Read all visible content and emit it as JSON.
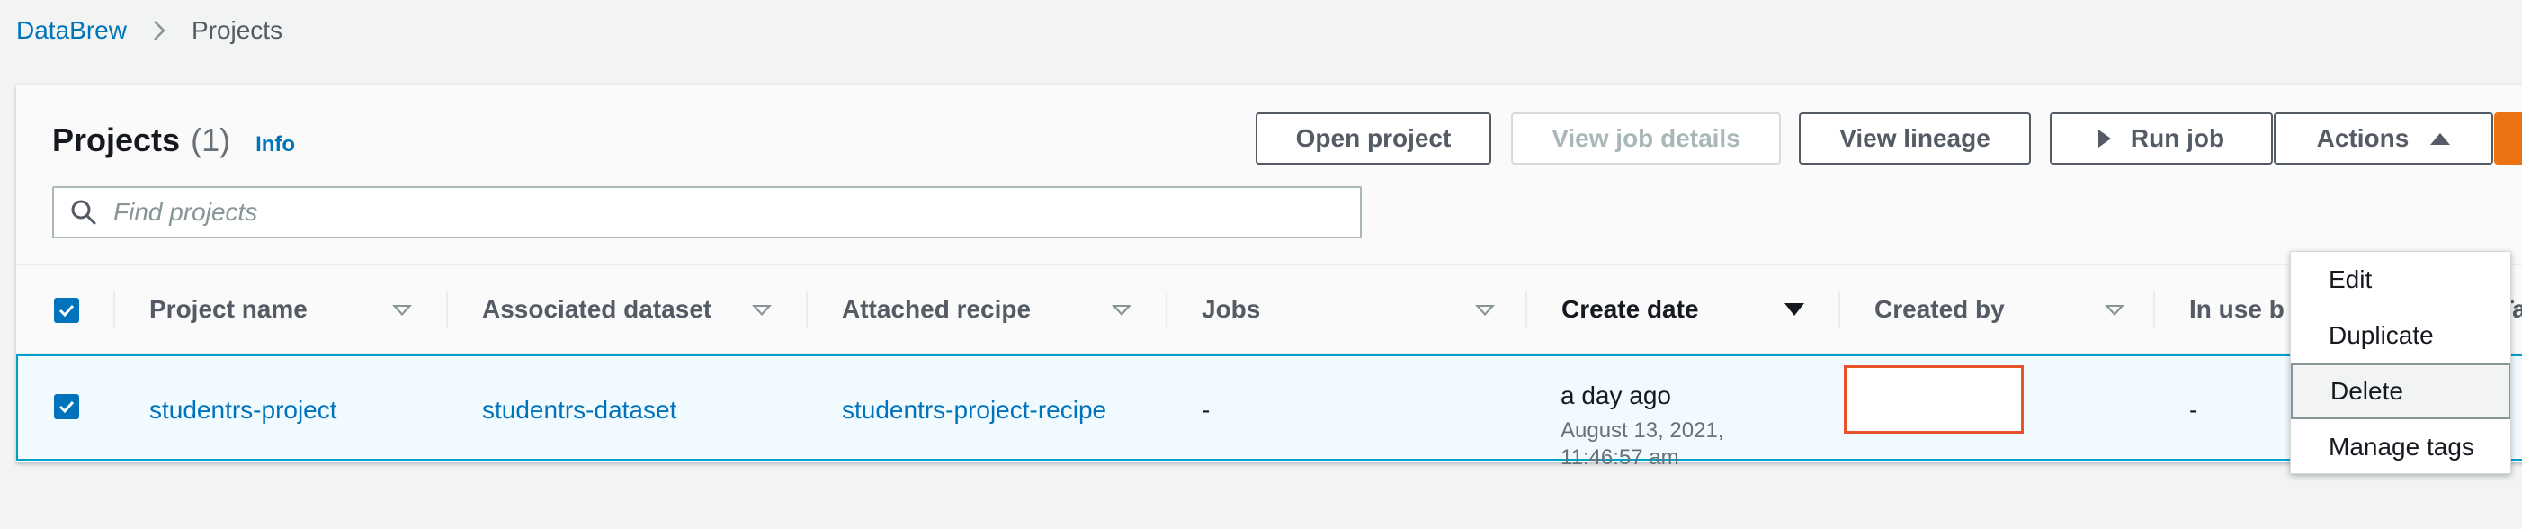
{
  "breadcrumb": {
    "root": "DataBrew",
    "current": "Projects"
  },
  "header": {
    "title": "Projects",
    "count": "(1)",
    "info": "Info"
  },
  "toolbar": {
    "open_project": "Open project",
    "view_job_details": "View job details",
    "view_lineage": "View lineage",
    "run_job": "Run job",
    "actions": "Actions"
  },
  "search": {
    "placeholder": "Find projects"
  },
  "table": {
    "columns": [
      "Project name",
      "Associated dataset",
      "Attached recipe",
      "Jobs",
      "Create date",
      "Created by",
      "In use b",
      "Ta"
    ],
    "sorted_column": "Create date",
    "rows": [
      {
        "selected": true,
        "project_name": "studentrs-project",
        "dataset": "studentrs-dataset",
        "recipe": "studentrs-project-recipe",
        "jobs": "-",
        "create_date_relative": "a day ago",
        "create_date_full": "August 13, 2021, 11:46:57 am",
        "created_by": "",
        "in_use_by": "-",
        "tags": "-"
      }
    ]
  },
  "actions_menu": {
    "items": [
      "Edit",
      "Duplicate",
      "Delete",
      "Manage tags"
    ],
    "highlighted": "Delete"
  },
  "colors": {
    "link": "#0073bb",
    "accent_orange": "#ec7211",
    "selected_row": "#f1faff",
    "selected_border": "#00a1c9",
    "redaction_box": "#e9532c"
  }
}
